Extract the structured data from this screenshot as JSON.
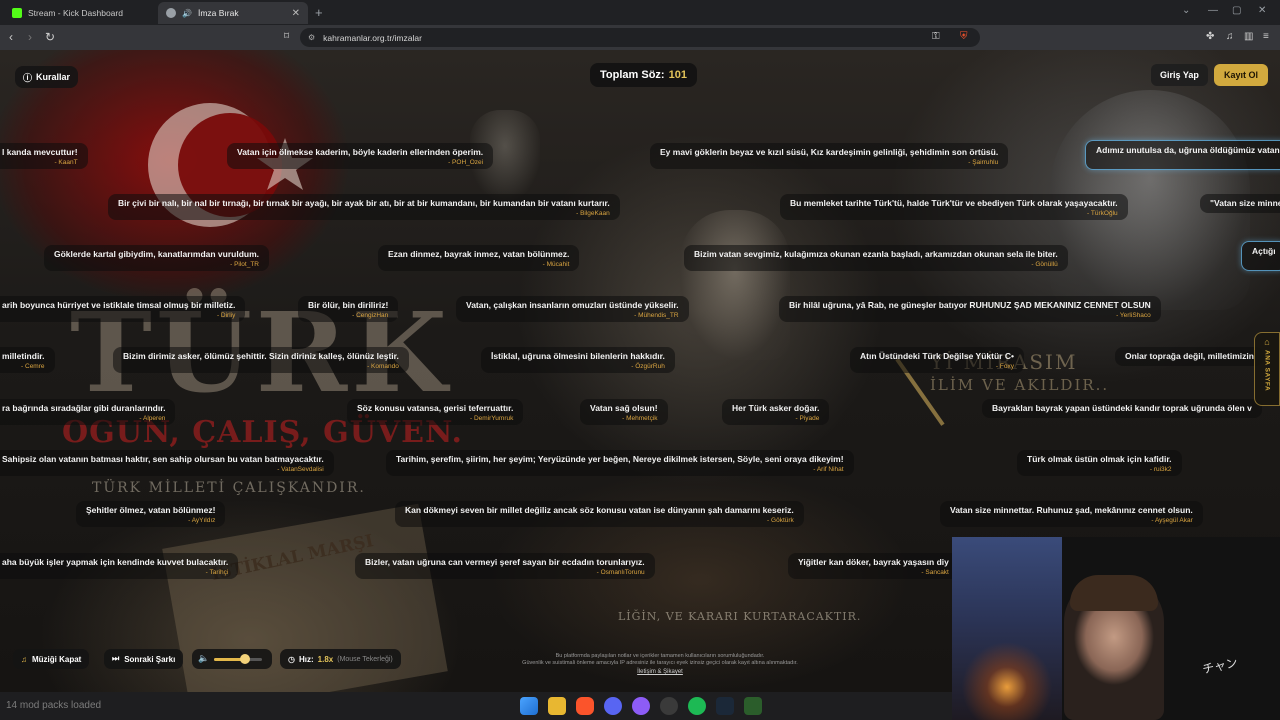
{
  "browser": {
    "tabs": [
      {
        "title": "Stream - Kick Dashboard",
        "active": false,
        "favicon_color": "#53fc18"
      },
      {
        "title": "İmza Bırak",
        "active": true,
        "favicon_color": "#9aa0a6"
      }
    ],
    "url": "kahramanlar.org.tr/imzalar"
  },
  "header": {
    "rules_label": "Kurallar",
    "counter_label": "Toplam Söz:",
    "counter_value": "101",
    "login_label": "Giriş Yap",
    "register_label": "Kayıt Ol"
  },
  "background_text": {
    "big_word": "TÜRK",
    "motto": "OGUN, ÇALIŞ, GÜVEN.",
    "motto2": "TÜRK MİLLETİ ÇALIŞKANDIR.",
    "mirasim": "Yİ MİRASIM",
    "ilim": "İLİM VE AKILDIR..",
    "istiklal": "İSTİKLAL MARŞI",
    "kurtar": "LİĞİN, VE KARARI KURTARACAKTIR."
  },
  "signatures": [
    {
      "quote": "l kanda mevcuttur!",
      "author": "- KaanT"
    },
    {
      "quote": "Vatan için ölmekse kaderim, böyle kaderin ellerinden öperim.",
      "author": "- POH_Ozei"
    },
    {
      "quote": "Ey mavi göklerin beyaz ve kızıl süsü, Kız kardeşimin gelinliği, şehidimin son örtüsü.",
      "author": "- Şairruhlu"
    },
    {
      "quote": "Adımız unutulsa da, uğruna öldüğümüz vatan",
      "author": ""
    },
    {
      "quote": "Bir çivi bir nalı, bir nal bir tırnağı, bir tırnak bir ayağı, bir ayak bir atı, bir at bir kumandanı, bir kumandan bir vatanı kurtarır.",
      "author": "- BilgeKaan"
    },
    {
      "quote": "Bu memleket tarihte Türk'tü, halde Türk'tür ve ebediyen Türk olarak yaşayacaktır.",
      "author": "- TürkOğlu"
    },
    {
      "quote": "\"Vatan size minne",
      "author": ""
    },
    {
      "quote": "Göklerde kartal gibiydim, kanatlarımdan vuruldum.",
      "author": "- Pilot_TR"
    },
    {
      "quote": "Ezan dinmez, bayrak inmez, vatan bölünmez.",
      "author": "- Mücahit"
    },
    {
      "quote": "Bizim vatan sevgimiz, kulağımıza okunan ezanla başladı, arkamızdan okunan sela ile biter.",
      "author": "- Gönüllü"
    },
    {
      "quote": "Açtığı",
      "author": ""
    },
    {
      "quote": "arih boyunca hürriyet ve istiklale timsal olmuş bir milletiz.",
      "author": "- Dirliy"
    },
    {
      "quote": "Bir ölür, bin diriliriz!",
      "author": "- CengizHan"
    },
    {
      "quote": "Vatan, çalışkan insanların omuzları üstünde yükselir.",
      "author": "- Mühendis_TR"
    },
    {
      "quote": "Bir hilâl uğruna, yâ Rab, ne güneşler batıyor RUHUNUZ ŞAD MEKANINIZ CENNET OLSUN",
      "author": "- YerliShaco"
    },
    {
      "quote": "milletindir.",
      "author": "- Cemre"
    },
    {
      "quote": "Bizim dirimiz asker, ölümüz şehittir. Sizin diriniz kalleş, ölünüz leştir.",
      "author": "- Komando"
    },
    {
      "quote": "İstiklal, uğruna ölmesini bilenlerin hakkıdır.",
      "author": "- ÖzgürRuh"
    },
    {
      "quote": "Atın Üstündeki Türk Değilse Yüktür C•",
      "author": "- Foxy"
    },
    {
      "quote": "Onlar toprağa değil, milletimizin",
      "author": ""
    },
    {
      "quote": "ra bağrında sıradağlar gibi duranlarındır.",
      "author": "- Alperen"
    },
    {
      "quote": "Söz konusu vatansa, gerisi teferruattır.",
      "author": "- DemirYumruk"
    },
    {
      "quote": "Vatan sağ olsun!",
      "author": "- Mehmetçik"
    },
    {
      "quote": "Her Türk asker doğar.",
      "author": "- Piyade"
    },
    {
      "quote": "Bayrakları bayrak yapan üstündeki kandır toprak uğrunda ölen v",
      "author": ""
    },
    {
      "quote": "Sahipsiz olan vatanın batması haktır, sen sahip olursan bu vatan batmayacaktır.",
      "author": "- VatanSevdalisi"
    },
    {
      "quote": "Tarihim, şerefim, şiirim, her şeyim; Yeryüzünde yer beğen, Nereye dikilmek istersen, Söyle, seni oraya dikeyim!",
      "author": "- Arif Nihat"
    },
    {
      "quote": "Türk olmak üstün olmak için kafidir.",
      "author": "- rui3k2"
    },
    {
      "quote": "Şehitler ölmez, vatan bölünmez!",
      "author": "- AyYıldız"
    },
    {
      "quote": "Kan dökmeyi seven bir millet değiliz ancak söz konusu vatan ise dünyanın şah damarını keseriz.",
      "author": "- Göktürk"
    },
    {
      "quote": "Vatan size minnettar. Ruhunuz şad, mekânınız cennet olsun.",
      "author": "- Ayşegül Akar"
    },
    {
      "quote": "aha büyük işler yapmak için kendinde kuvvet bulacaktır.",
      "author": "- Tarihçi"
    },
    {
      "quote": "Bizler, vatan uğruna can vermeyi şeref sayan bir ecdadın torunlarıyız.",
      "author": "- OsmanlıTorunu"
    },
    {
      "quote": "Yiğitler kan döker, bayrak yaşasın diy",
      "author": "- Sancakt"
    }
  ],
  "side_tab": {
    "label": "ANA SAYFA"
  },
  "controls": {
    "music_label": "Müziği Kapat",
    "next_label": "Sonraki Şarkı",
    "volume": 0.65,
    "speed_label": "Hız:",
    "speed_value": "1.8x",
    "speed_hint": "(Mouse Tekerleği)"
  },
  "footer": {
    "line1": "Bu platformda paylaşılan notlar ve içerikler tamamen kullanıcıların sorumluluğundadır.",
    "line2": "Güvenlik ve suistimali önleme amacıyla IP adresiniz ile tarayıcı eyek izinsiz geçici olarak kayıt altına alınmaktadır.",
    "contact": "İletişim & Şikayet"
  },
  "taskbar": {
    "status_text": "14 mod packs loaded"
  },
  "webcam": {
    "overlay_text": "チャン"
  },
  "colors": {
    "accent_gold": "#d1a93e",
    "author_gold": "#d9a441",
    "highlight_blue": "#6ec8ff"
  }
}
